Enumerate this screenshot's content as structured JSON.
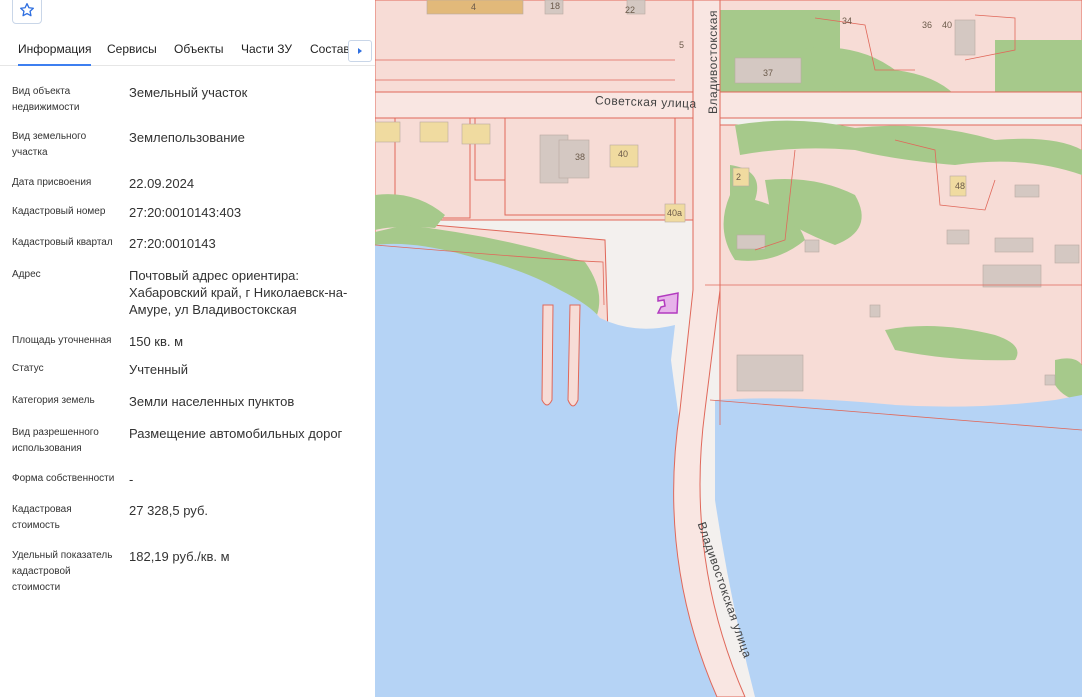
{
  "panel": {
    "favorite_icon": "star-icon",
    "tabs": [
      {
        "label": "Информация"
      },
      {
        "label": "Сервисы"
      },
      {
        "label": "Объекты"
      },
      {
        "label": "Части ЗУ"
      },
      {
        "label": "Состав"
      }
    ],
    "tabs_next_icon": "chevron-right-icon",
    "fields": {
      "object_type": {
        "label": "Вид объекта недвижимости",
        "value": "Земельный участок"
      },
      "land_type": {
        "label": "Вид земельного участка",
        "value": "Землепользование"
      },
      "assign_date": {
        "label": "Дата присвоения",
        "value": "22.09.2024"
      },
      "cad_number": {
        "label": "Кадастровый номер",
        "value": "27:20:0010143:403"
      },
      "cad_quarter": {
        "label": "Кадастровый квартал",
        "value": "27:20:0010143"
      },
      "address": {
        "label": "Адрес",
        "value": "Почтовый адрес ориентира: Хабаровский край, г Николаевск-на-Амуре, ул Владивостокская"
      },
      "area": {
        "label": "Площадь уточненная",
        "value": "150 кв. м"
      },
      "status": {
        "label": "Статус",
        "value": "Учтенный"
      },
      "land_category": {
        "label": "Категория земель",
        "value": "Земли населенных пунктов"
      },
      "permitted_use": {
        "label": "Вид разрешенного использования",
        "value": "Размещение автомобильных дорог"
      },
      "ownership": {
        "label": "Форма собственности",
        "value": "-"
      },
      "cad_cost": {
        "label": "Кадастровая стоимость",
        "value": "27 328,5 руб."
      },
      "specific_cost": {
        "label": "Удельный показатель кадастровой стоимости",
        "value": "182,19 руб./кв. м"
      }
    }
  },
  "map": {
    "streets": {
      "sovetskaya": "Советская улица",
      "vladivostokskaya_north": "Владивостокская",
      "vladivostokskaya_south": "Владивостокская улица"
    },
    "house_numbers": [
      "4",
      "18",
      "22",
      "5",
      "37",
      "38",
      "40",
      "40а",
      "2",
      "48",
      "34",
      "36",
      "40"
    ],
    "colors": {
      "water": "#b5d3f5",
      "parcel_fill": "#f7dcd6",
      "parcel_line": "#e0685a",
      "vegetation": "#a6c98b",
      "building": "#d4c8c2",
      "selected_parcel": "#b23bbf"
    }
  }
}
